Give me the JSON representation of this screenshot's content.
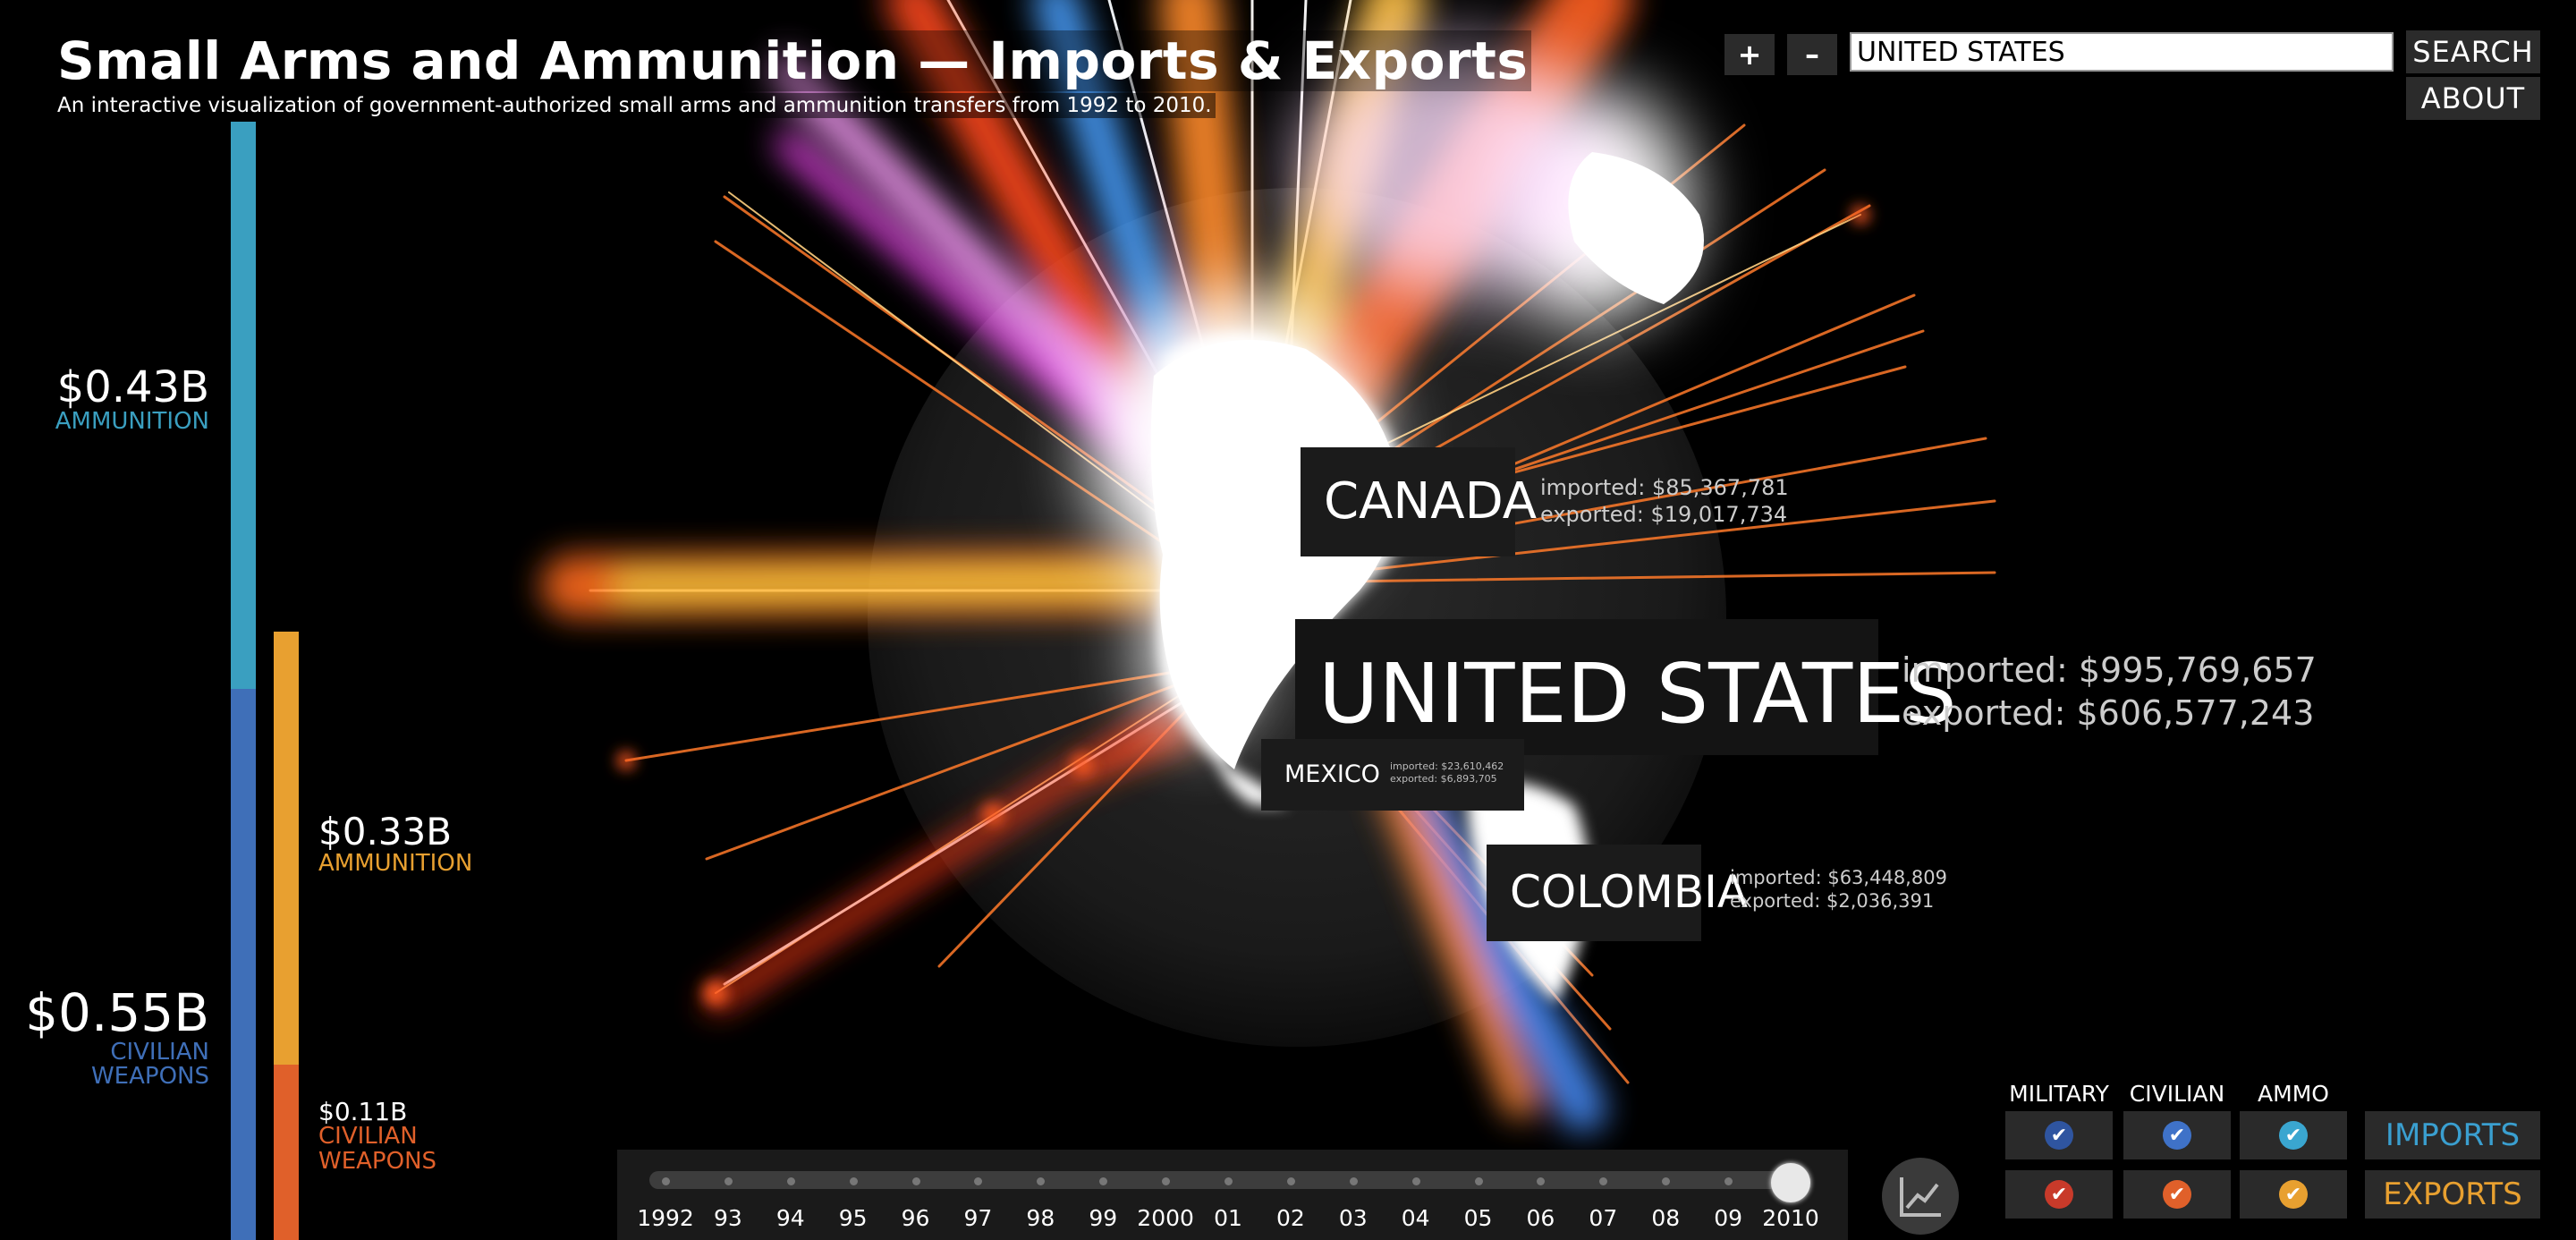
{
  "header": {
    "title": "Small Arms and Ammunition — Imports & Exports",
    "subtitle": "An interactive visualization of government-authorized small arms and ammunition transfers from 1992 to 2010."
  },
  "controls": {
    "zoom_in_label": "+",
    "zoom_out_label": "–",
    "search_value": "UNITED STATES",
    "search_label": "SEARCH",
    "about_label": "ABOUT"
  },
  "left_panel": {
    "import_ammo_value": "$0.43B",
    "import_ammo_label": "AMMUNITION",
    "import_civilian_value": "$0.55B",
    "import_civilian_label_1": "CIVILIAN",
    "import_civilian_label_2": "WEAPONS",
    "export_ammo_value": "$0.33B",
    "export_ammo_label": "AMMUNITION",
    "export_civilian_value": "$0.11B",
    "export_civilian_label_1": "CIVILIAN",
    "export_civilian_label_2": "WEAPONS",
    "colors": {
      "import_ammo": "#3a9fc0",
      "import_civilian": "#3f6fb8",
      "export_ammo": "#e8a030",
      "export_civilian": "#e0602a"
    }
  },
  "countries": {
    "canada": {
      "name": "CANADA",
      "imported": "imported: $85,367,781",
      "exported": "exported: $19,017,734"
    },
    "usa": {
      "name": "UNITED STATES",
      "imported": "imported: $995,769,657",
      "exported": "exported: $606,577,243"
    },
    "mexico": {
      "name": "MEXICO",
      "imported": "imported: $23,610,462",
      "exported": "exported: $6,893,705"
    },
    "colombia": {
      "name": "COLOMBIA",
      "imported": "imported: $63,448,809",
      "exported": "exported: $2,036,391"
    }
  },
  "timeline": {
    "years": [
      "1992",
      "93",
      "94",
      "95",
      "96",
      "97",
      "98",
      "99",
      "2000",
      "01",
      "02",
      "03",
      "04",
      "05",
      "06",
      "07",
      "08",
      "09",
      "2010"
    ],
    "selected": "2010"
  },
  "filters": {
    "military_label": "MILITARY",
    "civilian_label": "CIVILIAN",
    "ammo_label": "AMMO",
    "imports_label": "IMPORTS",
    "exports_label": "EXPORTS",
    "import_color": "#3a9fd0",
    "export_color": "#e8a030"
  }
}
